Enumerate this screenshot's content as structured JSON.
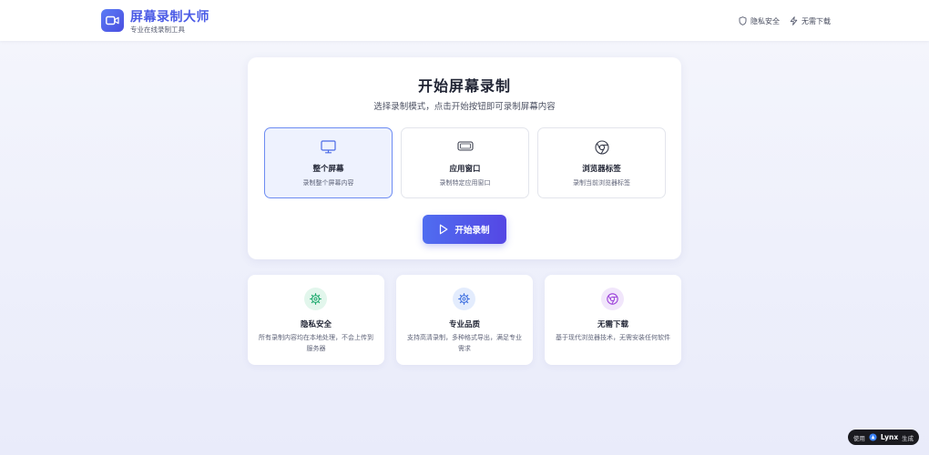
{
  "header": {
    "app_title": "屏幕录制大师",
    "app_subtitle": "专业在线录制工具",
    "logo_icon": "video-camera-icon",
    "nav": [
      {
        "label": "隐私安全",
        "icon": "shield-icon"
      },
      {
        "label": "无需下载",
        "icon": "lightning-icon"
      }
    ]
  },
  "main": {
    "title": "开始屏幕录制",
    "subtitle": "选择录制模式，点击开始按钮即可录制屏幕内容",
    "modes": [
      {
        "title": "整个屏幕",
        "desc": "录制整个屏幕内容",
        "icon": "monitor-icon",
        "selected": true
      },
      {
        "title": "应用窗口",
        "desc": "录制特定应用窗口",
        "icon": "window-icon",
        "selected": false
      },
      {
        "title": "浏览器标签",
        "desc": "录制当前浏览器标签",
        "icon": "chrome-icon",
        "selected": false
      }
    ],
    "start_button": "开始录制"
  },
  "features": [
    {
      "title": "隐私安全",
      "desc": "所有录制内容均在本地处理，不会上传到服务器",
      "icon": "gear-icon",
      "color": "#1aa86b",
      "bg": "#e2f6ec"
    },
    {
      "title": "专业品质",
      "desc": "支持高清录制，多种格式导出，满足专业需求",
      "icon": "gear-icon",
      "color": "#3d6fe0",
      "bg": "#e3ecfd"
    },
    {
      "title": "无需下载",
      "desc": "基于现代浏览器技术，无需安装任何软件",
      "icon": "chrome-icon",
      "color": "#9a3fd8",
      "bg": "#f1e6fb"
    }
  ],
  "badge": {
    "prefix": "使用",
    "brand": "Lynx",
    "suffix": "生成"
  },
  "colors": {
    "accent": "#4a5ae6",
    "button_gradient_start": "#4f6df0",
    "button_gradient_end": "#5547e4",
    "selected_border": "#6d8cf2"
  }
}
